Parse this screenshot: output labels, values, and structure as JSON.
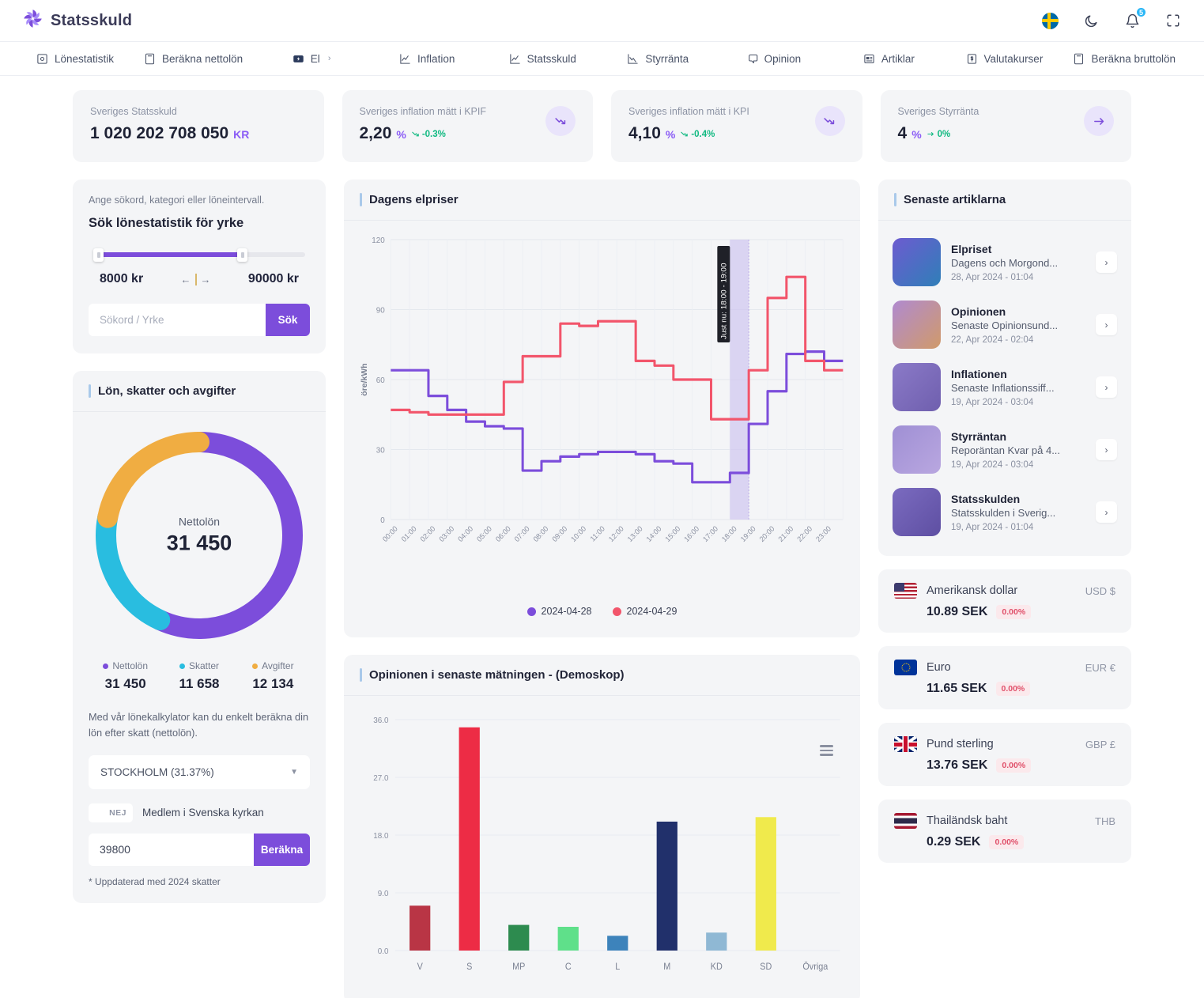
{
  "brand": {
    "name": "Statsskuld",
    "logo_icon": "pinwheel-logo-icon"
  },
  "topbar": {
    "icons": [
      {
        "name": "language-flag-sweden-icon",
        "label": "Svenska"
      },
      {
        "name": "dark-mode-moon-icon",
        "label": "Mörkt läge"
      },
      {
        "name": "notifications-bell-icon",
        "label": "Notiser",
        "badge": "5"
      },
      {
        "name": "fullscreen-icon",
        "label": "Helskärm"
      }
    ]
  },
  "nav": {
    "items": [
      {
        "label": "Lönestatistik",
        "icon": "target-icon",
        "has_chevron": false
      },
      {
        "label": "Beräkna nettolön",
        "icon": "calculator-icon",
        "has_chevron": false
      },
      {
        "label": "El",
        "icon": "lightning-bolt-icon",
        "has_chevron": true
      },
      {
        "label": "Inflation",
        "icon": "line-chart-up-icon",
        "has_chevron": false
      },
      {
        "label": "Statsskuld",
        "icon": "line-chart-up-icon",
        "has_chevron": false
      },
      {
        "label": "Styrränta",
        "icon": "line-chart-down-icon",
        "has_chevron": false
      },
      {
        "label": "Opinion",
        "icon": "speech-bubble-icon",
        "has_chevron": false
      },
      {
        "label": "Artiklar",
        "icon": "article-icon",
        "has_chevron": false
      },
      {
        "label": "Valutakurser",
        "icon": "money-bill-icon",
        "has_chevron": false
      },
      {
        "label": "Beräkna bruttolön",
        "icon": "calculator-icon",
        "has_chevron": false
      }
    ]
  },
  "stats": [
    {
      "label": "Sveriges Statsskuld",
      "value": "1 020 202 708 050",
      "unit": "KR",
      "delta": "",
      "trend_icon": "",
      "show_badge": false
    },
    {
      "label": "Sveriges inflation mätt i KPIF",
      "value": "2,20",
      "unit": "%",
      "delta": "-0.3%",
      "trend_icon": "trend-down-icon",
      "show_badge": true
    },
    {
      "label": "Sveriges inflation mätt i KPI",
      "value": "4,10",
      "unit": "%",
      "delta": "-0.4%",
      "trend_icon": "trend-down-icon",
      "show_badge": true
    },
    {
      "label": "Sveriges Styrränta",
      "value": "4",
      "unit": "%",
      "delta": "0%",
      "trend_icon": "trend-flat-icon",
      "show_badge": true
    }
  ],
  "search_panel": {
    "subtitle": "Ange sökord, kategori eller löneintervall.",
    "heading": "Sök lönestatistik för yrke",
    "min_label": "8000 kr",
    "max_label": "90000 kr",
    "input_placeholder": "Sökord / Yrke",
    "input_value": "",
    "button_label": "Sök"
  },
  "salary_card": {
    "title": "Lön, skatter och avgifter",
    "center_label": "Nettolön",
    "center_value": "31 450",
    "legend": [
      {
        "label": "Nettolön",
        "value": "31 450",
        "color": "#7c4ddb"
      },
      {
        "label": "Skatter",
        "value": "11 658",
        "color": "#29bde0"
      },
      {
        "label": "Avgifter",
        "value": "12 134",
        "color": "#f0ad42"
      }
    ],
    "description": "Med vår lönekalkylator kan du enkelt beräkna din lön efter skatt (nettolön).",
    "municipality": "STOCKHOLM (31.37%)",
    "church_toggle_state": "NEJ",
    "church_label": "Medlem i Svenska kyrkan",
    "salary_input_value": "39800",
    "calc_button_label": "Beräkna",
    "footnote": "* Uppdaterad med 2024 skatter"
  },
  "electricity_card": {
    "title": "Dagens elpriser",
    "now_tooltip": "Just nu: 18:00 - 19:00"
  },
  "opinion_card": {
    "title": "Opinionen i senaste mätningen - (Demoskop)",
    "menu_icon": "hamburger-menu-icon"
  },
  "articles_card": {
    "title": "Senaste artiklarna",
    "items": [
      {
        "title": "Elpriset",
        "subtitle": "Dagens och Morgond...",
        "date": "28, Apr 2024 - 01:04",
        "thumb": "electricity-sunset-thumb"
      },
      {
        "title": "Opinionen",
        "subtitle": "Senaste Opinionsund...",
        "date": "22, Apr 2024 - 02:04",
        "thumb": "opinion-hand-thumb"
      },
      {
        "title": "Inflationen",
        "subtitle": "Senaste Inflationssiff...",
        "date": "19, Apr 2024 - 03:04",
        "thumb": "inflation-city-thumb"
      },
      {
        "title": "Styrräntan",
        "subtitle": "Reporäntan Kvar på 4...",
        "date": "19, Apr 2024 - 03:04",
        "thumb": "interest-coin-thumb"
      },
      {
        "title": "Statsskulden",
        "subtitle": "Statsskulden i Sverig...",
        "date": "19, Apr 2024 - 01:04",
        "thumb": "debt-flag-thumb"
      }
    ]
  },
  "currencies": [
    {
      "name": "Amerikansk dollar",
      "code": "USD $",
      "rate": "10.89 SEK",
      "change": "0.00%",
      "flag": "us-flag-icon"
    },
    {
      "name": "Euro",
      "code": "EUR €",
      "rate": "11.65 SEK",
      "change": "0.00%",
      "flag": "eu-flag-icon"
    },
    {
      "name": "Pund sterling",
      "code": "GBP £",
      "rate": "13.76 SEK",
      "change": "0.00%",
      "flag": "gb-flag-icon"
    },
    {
      "name": "Thailändsk baht",
      "code": "THB",
      "rate": "0.29 SEK",
      "change": "0.00%",
      "flag": "th-flag-icon"
    }
  ],
  "chart_data": [
    {
      "type": "line",
      "chart_style": "step",
      "title": "Dagens elpriser",
      "xlabel": "",
      "ylabel": "öre/kWh",
      "ylim": [
        0,
        120
      ],
      "yticks": [
        0,
        30,
        60,
        90,
        120
      ],
      "grid": true,
      "legend_position": "bottom",
      "highlight_band": {
        "from": "18:00",
        "to": "19:00",
        "label": "Just nu: 18:00 - 19:00",
        "color": "#cdc2f0"
      },
      "x": [
        "00:00",
        "01:00",
        "02:00",
        "03:00",
        "04:00",
        "05:00",
        "06:00",
        "07:00",
        "08:00",
        "09:00",
        "10:00",
        "11:00",
        "12:00",
        "13:00",
        "14:00",
        "15:00",
        "16:00",
        "17:00",
        "18:00",
        "19:00",
        "20:00",
        "21:00",
        "22:00",
        "23:00"
      ],
      "series": [
        {
          "name": "2024-04-28",
          "color": "#7c4ddb",
          "values": [
            64,
            64,
            53,
            47,
            42,
            40,
            39,
            21,
            25,
            27,
            28,
            29,
            29,
            28,
            25,
            24,
            16,
            16,
            20,
            41,
            55,
            71,
            72,
            68
          ]
        },
        {
          "name": "2024-04-29",
          "color": "#f2556b",
          "values": [
            47,
            46,
            45,
            45,
            45,
            45,
            59,
            70,
            70,
            84,
            83,
            85,
            85,
            68,
            66,
            60,
            60,
            43,
            43,
            64,
            95,
            104,
            68,
            64
          ]
        }
      ]
    },
    {
      "type": "bar",
      "title": "Opinionen i senaste mätningen - (Demoskop)",
      "xlabel": "",
      "ylabel": "",
      "ylim": [
        0,
        36
      ],
      "yticks": [
        "0.0",
        "9.0",
        "18.0",
        "27.0",
        "36.0"
      ],
      "grid": true,
      "categories": [
        "V",
        "S",
        "MP",
        "C",
        "L",
        "M",
        "KD",
        "SD",
        "Övriga"
      ],
      "values": [
        7.0,
        34.8,
        4.0,
        3.7,
        2.3,
        20.1,
        2.8,
        20.8,
        0.0
      ],
      "colors": [
        "#b93545",
        "#ed2c45",
        "#2d8b4f",
        "#5fe08a",
        "#3d83bb",
        "#21306b",
        "#8fb8d4",
        "#f0ea4c",
        "#f4f5f7"
      ]
    }
  ]
}
